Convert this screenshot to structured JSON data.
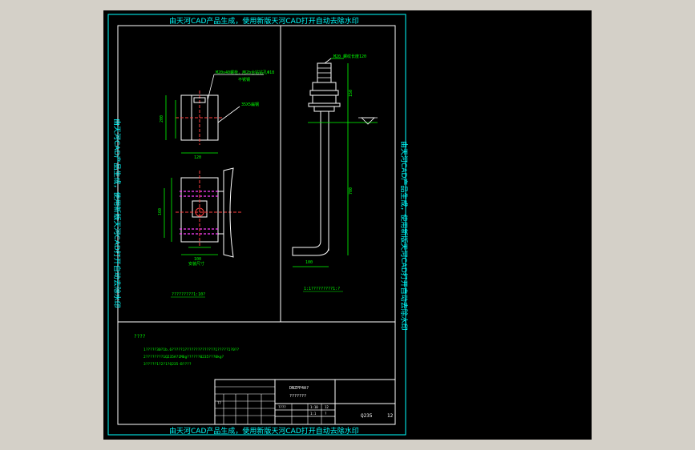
{
  "viewport": {
    "background": "#000000",
    "frame_color": "#00ffff",
    "outer_background": "#d4d0c8"
  },
  "watermark": {
    "top": "由天河CAD产品生成，使用新版天河CAD打开自动去除水印",
    "bottom": "由天河CAD产品生成，使用新版天河CAD打开自动去除水印",
    "left": "由天河CAD产品生成，使用新版天河CAD打开自动去除水印",
    "right": "由天河CAD产品生成，使用新版天河CAD打开自动去除水印"
  },
  "left_view": {
    "callout_top": "M20x40螺栓，用2b台钻钻孔Φ18",
    "callout_top_2": "不锈钢",
    "callout_mid": "35X5扁钢",
    "dim_width_top": "120",
    "dim_height_top": "200",
    "dim_width_bottom": "100",
    "dim_height_bottom": "160",
    "dim_bottom_label": "安装尺寸",
    "caption": "?????????1:10?"
  },
  "right_view": {
    "callout_top": "M20  螺纹长度120",
    "dim_vertical": "700",
    "dim_horizontal": "100",
    "dim_top": "150",
    "caption": "1:1?????????1:?"
  },
  "notes": {
    "title": "????",
    "line1": "1?????30?1b.6?????1??????????????1?????1?0??",
    "line2": "2????????1Q235A?1M6g??????0235???0kg?",
    "line3": "3?????1?2?1?Q235-B????"
  },
  "title_block": {
    "drawing_no": "DNZPP4A?",
    "name": "???????",
    "material": "Q235",
    "sheet": "12",
    "small_labels": [
      "????",
      "1:10",
      "12",
      "1:1",
      "?",
      "??"
    ]
  }
}
